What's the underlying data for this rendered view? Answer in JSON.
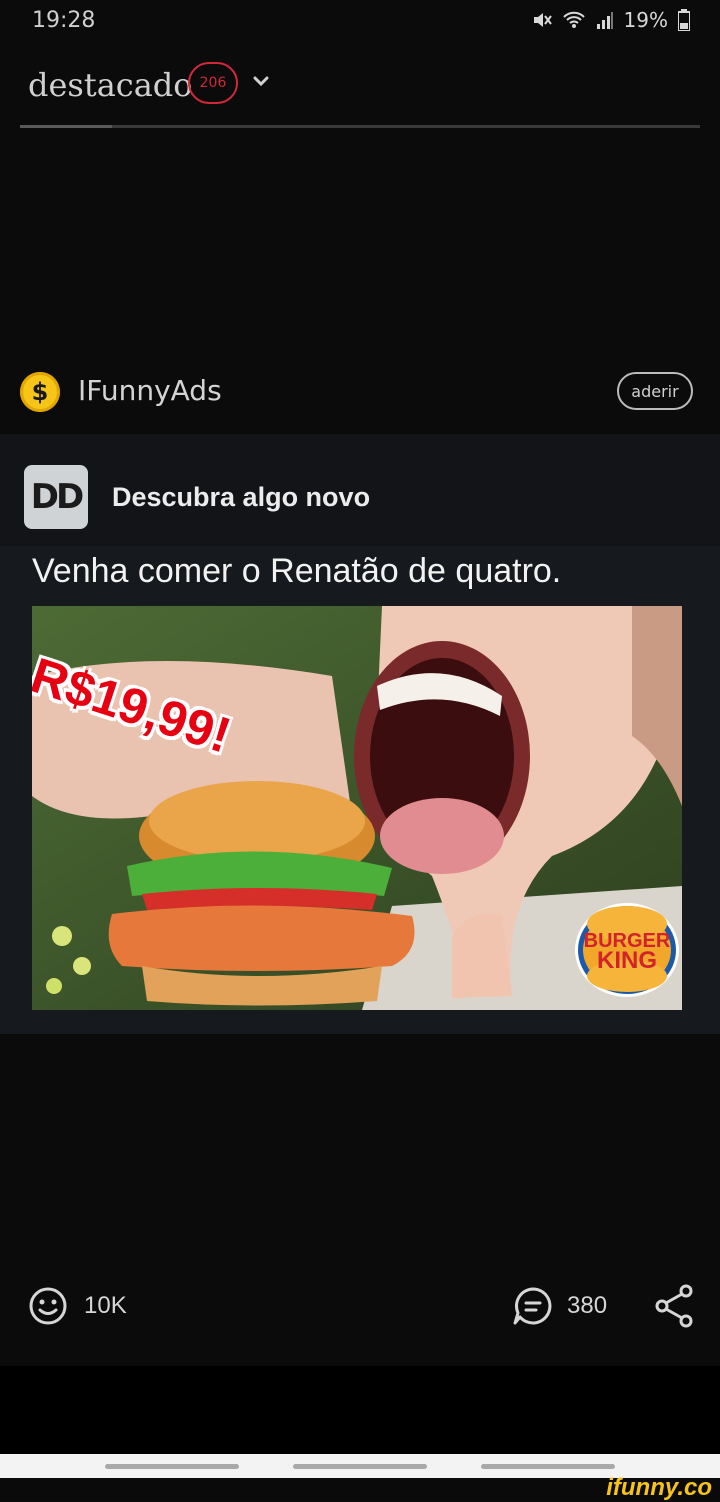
{
  "status_bar": {
    "time": "19:28",
    "battery": "19%"
  },
  "header": {
    "title": "destacado",
    "badge": "206"
  },
  "ad_header": {
    "coin_symbol": "$",
    "name": "IFunnyAds",
    "join_label": "aderir"
  },
  "sponsor": {
    "logo_text": "DD",
    "title": "Descubra algo novo",
    "ad_text": "Venha comer o Renatão de quatro."
  },
  "ad_image": {
    "price": "R$19,99!",
    "brand_line1": "BURGER",
    "brand_line2": "KING"
  },
  "actions": {
    "smiles": "10K",
    "comments": "380"
  },
  "watermark": "ifunny.co",
  "colors": {
    "badge": "#d0293a",
    "coin": "#f5c518",
    "price": "#e60012",
    "watermark": "#f7c318"
  }
}
